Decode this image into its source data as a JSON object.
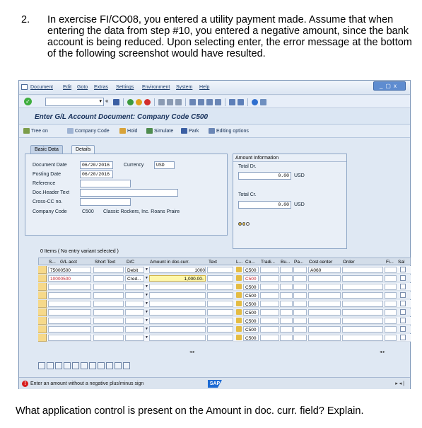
{
  "question": {
    "number": "2.",
    "text": "In exercise FI/CO08, you entered a utility payment made. Assume that when entering the data from step #10, you entered a negative amount, since the bank account is being reduced. Upon selecting enter, the error message at the bottom of the following screenshot would have resulted.",
    "followup": "What application control is present on the Amount in doc. curr. field?  Explain."
  },
  "menu": {
    "items": [
      "Document",
      "Edit",
      "Goto",
      "Extras",
      "Settings",
      "Environment",
      "System",
      "Help"
    ]
  },
  "toolbar": {
    "command_value": "«"
  },
  "screen_title": "Enter G/L Account Document: Company Code C500",
  "app_toolbar": {
    "tree_on": "Tree on",
    "company_code": "Company Code",
    "hold": "Hold",
    "simulate": "Simulate",
    "park": "Park",
    "editing_options": "Editing options"
  },
  "tabs": {
    "basic_data": "Basic Data",
    "details": "Details"
  },
  "header": {
    "document_date_label": "Document Date",
    "document_date": "06/20/2016",
    "currency_label": "Currency",
    "currency": "USD",
    "posting_date_label": "Posting Date",
    "posting_date": "06/20/2016",
    "reference_label": "Reference",
    "doc_header_label": "Doc.Header Text",
    "cross_cc_label": "Cross-CC no.",
    "company_code_label": "Company Code",
    "company_code": "C500",
    "company_name": "Classic Rockers, Inc. Roans Praire"
  },
  "amount_info": {
    "title": "Amount Information",
    "total_dr_label": "Total Dr.",
    "total_dr": "0.00",
    "total_dr_cur": "USD",
    "total_cr_label": "Total Cr.",
    "total_cr": "0.00",
    "total_cr_cur": "USD"
  },
  "items": {
    "label": "0 Items ( No entry variant selected )",
    "columns": [
      "S...",
      "G/L acct",
      "Short Text",
      "D/C",
      "Amount in doc.curr.",
      "Text",
      "L...",
      "Co...",
      "Tradi...",
      "Bu...",
      "Pa...",
      "Cost center",
      "Order",
      "Fi...",
      "Sal"
    ],
    "rows": [
      {
        "gl": "75000500",
        "dc": "Debit",
        "amount": "1000",
        "co": "C500",
        "cost_center": "A060"
      },
      {
        "gl": "10000500",
        "dc": "Cred...",
        "amount": "1,000.00-",
        "co": "C500",
        "cost_center": ""
      },
      {
        "gl": "",
        "dc": "",
        "amount": "",
        "co": "C500",
        "cost_center": ""
      },
      {
        "gl": "",
        "dc": "",
        "amount": "",
        "co": "C500",
        "cost_center": ""
      },
      {
        "gl": "",
        "dc": "",
        "amount": "",
        "co": "C500",
        "cost_center": ""
      },
      {
        "gl": "",
        "dc": "",
        "amount": "",
        "co": "C500",
        "cost_center": ""
      },
      {
        "gl": "",
        "dc": "",
        "amount": "",
        "co": "C500",
        "cost_center": ""
      },
      {
        "gl": "",
        "dc": "",
        "amount": "",
        "co": "C500",
        "cost_center": ""
      },
      {
        "gl": "",
        "dc": "",
        "amount": "",
        "co": "C500",
        "cost_center": ""
      }
    ]
  },
  "status": {
    "message": "Enter an amount without a negative plus/minus sign",
    "logo": "SAP"
  }
}
